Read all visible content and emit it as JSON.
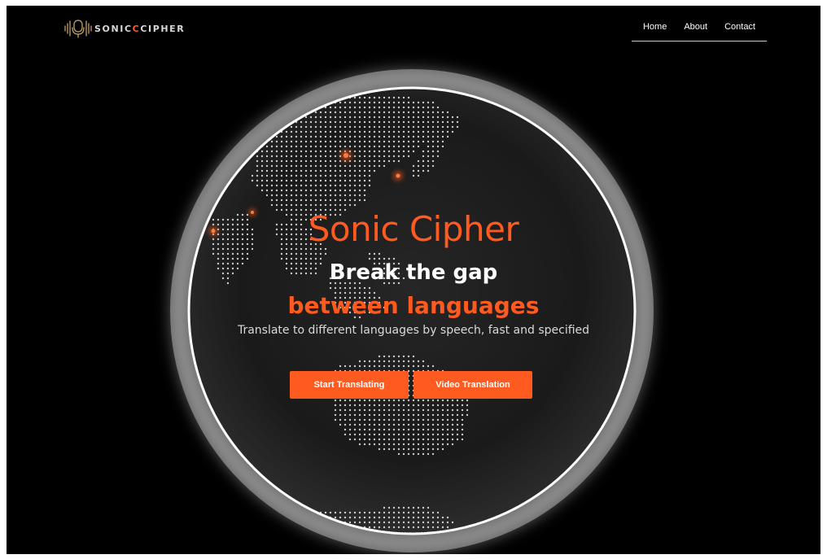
{
  "header": {
    "logo": {
      "text_part1": "SONIC",
      "text_part2": "C",
      "text_part3": "CIPHER",
      "icon": "microphone-soundwave-icon"
    },
    "nav": [
      {
        "label": "Home"
      },
      {
        "label": "About"
      },
      {
        "label": "Contact"
      }
    ]
  },
  "hero": {
    "title": "Sonic Cipher",
    "line1": "Break the gap",
    "line2": "between languages",
    "description": "Translate to different languages by speech, fast and specified",
    "buttons": {
      "start": "Start Translating",
      "video": "Video Translation"
    }
  },
  "colors": {
    "accent": "#ff5a1f",
    "background": "#000000",
    "text": "#ffffff",
    "globe_rim": "#ffffff"
  }
}
